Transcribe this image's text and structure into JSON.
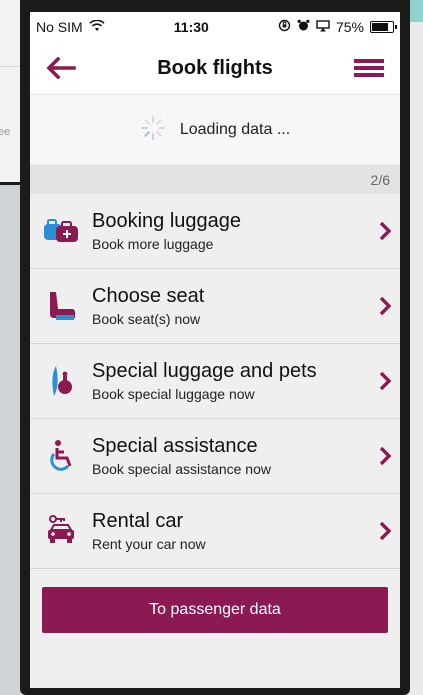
{
  "status_bar": {
    "carrier": "No SIM",
    "time": "11:30",
    "battery": "75%"
  },
  "header": {
    "title": "Book flights"
  },
  "loading": {
    "text": "Loading data ..."
  },
  "progress": {
    "step": "2/6"
  },
  "items": [
    {
      "title": "Booking luggage",
      "subtitle": "Book more luggage",
      "icon": "luggage-icon"
    },
    {
      "title": "Choose seat",
      "subtitle": "Book seat(s) now",
      "icon": "seat-icon"
    },
    {
      "title": "Special luggage and pets",
      "subtitle": "Book special luggage now",
      "icon": "special-luggage-icon"
    },
    {
      "title": "Special assistance",
      "subtitle": "Book special assistance now",
      "icon": "wheelchair-icon"
    },
    {
      "title": "Rental car",
      "subtitle": "Rent your car now",
      "icon": "car-icon"
    }
  ],
  "cta": {
    "label": "To passenger data"
  },
  "colors": {
    "accent": "#8c1a52",
    "icon_blue": "#2b8fd6"
  }
}
